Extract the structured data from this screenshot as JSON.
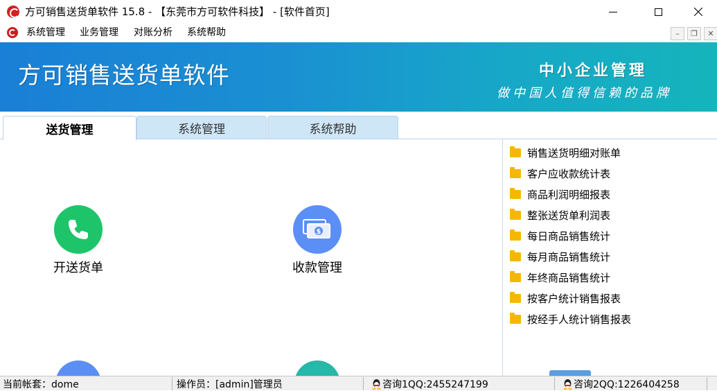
{
  "window": {
    "title": "方可销售送货单软件 15.8 - 【东莞市方可软件科技】 - [软件首页]"
  },
  "menu": {
    "items": [
      "系统管理",
      "业务管理",
      "对账分析",
      "系统帮助"
    ]
  },
  "banner": {
    "title": "方可销售送货单软件",
    "subtitle1": "中小企业管理",
    "subtitle2": "做中国人值得信赖的品牌"
  },
  "tabs": [
    {
      "label": "送货管理",
      "active": true
    },
    {
      "label": "系统管理",
      "active": false
    },
    {
      "label": "系统帮助",
      "active": false
    }
  ],
  "launchers": [
    {
      "label": "开送货单",
      "icon": "phone-icon",
      "color": "#1ec46a"
    },
    {
      "label": "收款管理",
      "icon": "money-icon",
      "color": "#5b8ff5"
    }
  ],
  "reports": [
    "销售送货明细对账单",
    "客户应收款统计表",
    "商品利润明细报表",
    "整张送货单利润表",
    "每日商品销售统计",
    "每月商品销售统计",
    "年终商品销售统计",
    "按客户统计销售报表",
    "按经手人统计销售报表"
  ],
  "status": {
    "account": "当前帐套：dome",
    "operator": "操作员：[admin]管理员",
    "qq1": "咨询1QQ:2455247199",
    "qq2": "咨询2QQ:1226404258"
  }
}
